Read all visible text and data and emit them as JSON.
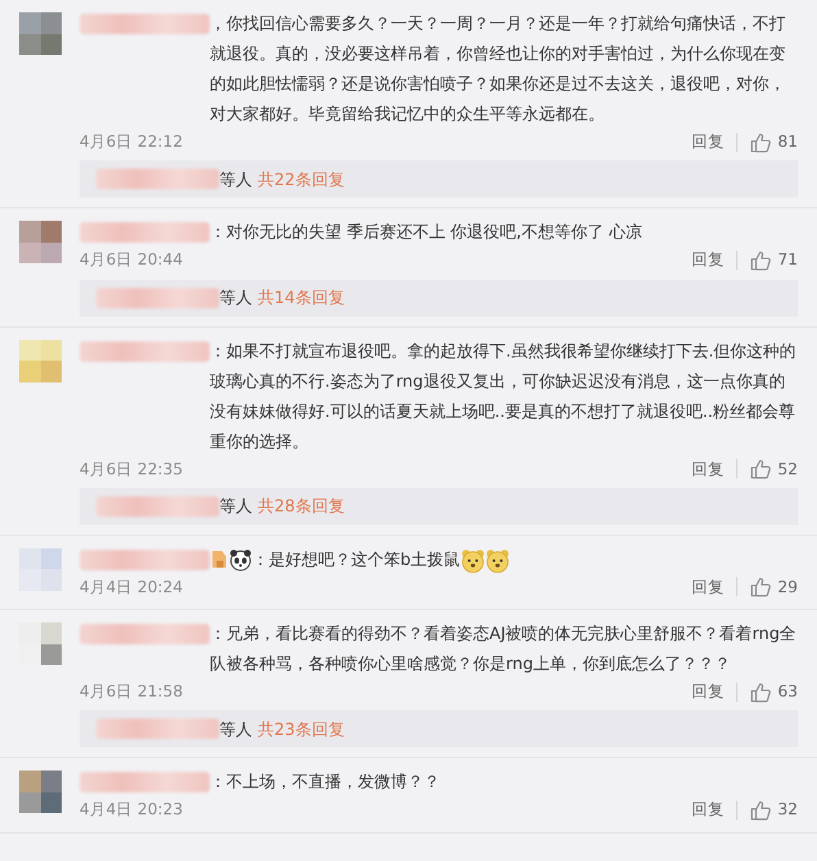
{
  "comments": [
    {
      "text": "，你找回信心需要多久？一天？一周？一月？还是一年？打就给句痛快话，不打就退役。真的，没必要这样吊着，你曾经也让你的对手害怕过，为什么你现在变的如此胆怯懦弱？还是说你害怕喷子？如果你还是过不去这关，退役吧，对你，对大家都好。毕竟留给我记忆中的众生平等永远都在。",
      "time": "4月6日 22:12",
      "reply": "回复",
      "likes": "81",
      "replies": {
        "suffix": "等人",
        "count": "共22条回复"
      }
    },
    {
      "text": "：对你无比的失望 季后赛还不上 你退役吧,不想等你了 心凉",
      "time": "4月6日 20:44",
      "reply": "回复",
      "likes": "71",
      "replies": {
        "suffix": "等人",
        "count": "共14条回复"
      }
    },
    {
      "text": "：如果不打就宣布退役吧。拿的起放得下.虽然我很希望你继续打下去.但你这种的玻璃心真的不行.姿态为了rng退役又复出，可你缺迟迟没有消息，这一点你真的没有妹妹做得好.可以的话夏天就上场吧..要是真的不想打了就退役吧..粉丝都会尊重你的选择。",
      "time": "4月6日 22:35",
      "reply": "回复",
      "likes": "52",
      "replies": {
        "suffix": "等人",
        "count": "共28条回复"
      }
    },
    {
      "name_icons": [
        {
          "kind": "badge"
        },
        {
          "kind": "panda"
        }
      ],
      "text": "：是好想吧？这个笨b土拨鼠",
      "emojis": [
        {
          "kind": "bear"
        },
        {
          "kind": "bear"
        }
      ],
      "time": "4月4日 20:24",
      "reply": "回复",
      "likes": "29"
    },
    {
      "text": "：兄弟，看比赛看的得劲不？看着姿态AJ被喷的体无完肤心里舒服不？看着rng全队被各种骂，各种喷你心里啥感觉？你是rng上单，你到底怎么了？？？",
      "time": "4月6日 21:58",
      "reply": "回复",
      "likes": "63",
      "replies": {
        "suffix": "等人",
        "count": "共23条回复"
      }
    },
    {
      "text": "：不上场，不直播，发微博？？",
      "time": "4月4日 20:23",
      "reply": "回复",
      "likes": "32"
    }
  ]
}
